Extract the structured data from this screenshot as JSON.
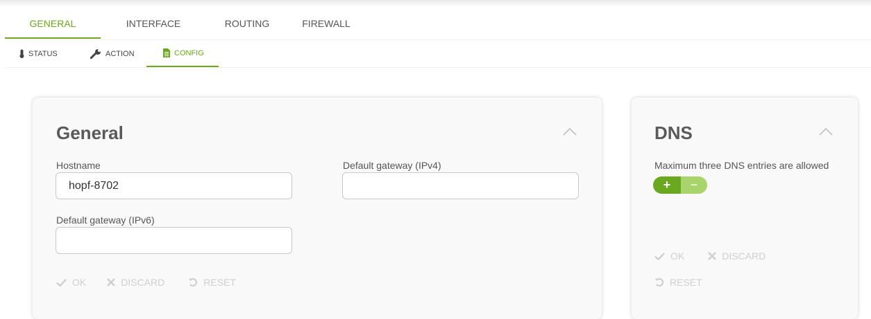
{
  "tabs": [
    {
      "label": "GENERAL",
      "active": true
    },
    {
      "label": "INTERFACE",
      "active": false
    },
    {
      "label": "ROUTING",
      "active": false
    },
    {
      "label": "FIREWALL",
      "active": false
    }
  ],
  "subtabs": [
    {
      "label": "STATUS",
      "icon": "thermometer-icon",
      "active": false
    },
    {
      "label": "ACTION",
      "icon": "wrench-icon",
      "active": false
    },
    {
      "label": "CONFIG",
      "icon": "document-icon",
      "active": true
    }
  ],
  "general": {
    "title": "General",
    "hostname_label": "Hostname",
    "hostname_value": "hopf-8702",
    "gw4_label": "Default gateway (IPv4)",
    "gw4_value": "",
    "gw6_label": "Default gateway (IPv6)",
    "gw6_value": "",
    "ok": "OK",
    "discard": "DISCARD",
    "reset": "RESET"
  },
  "dns": {
    "title": "DNS",
    "note": "Maximum three DNS entries are allowed",
    "plus": "+",
    "minus": "−",
    "ok": "OK",
    "discard": "DISCARD",
    "reset": "RESET"
  },
  "colors": {
    "accent": "#6aa81f",
    "accent_light": "#a9d36b",
    "disabled": "#cfcfcf"
  }
}
